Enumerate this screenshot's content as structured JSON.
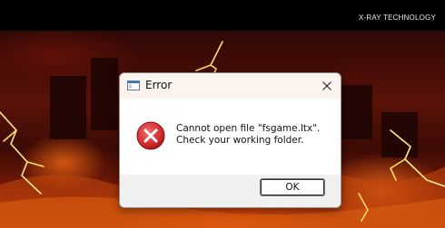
{
  "splash": {
    "brand": "X-RAY TECHNOLOGY"
  },
  "dialog": {
    "title": "Error",
    "message_line1": "Cannot open file \"fsgame.ltx\".",
    "message_line2": "Check your working folder.",
    "ok_label": "OK",
    "icon": "error-icon",
    "title_icon": "window-icon",
    "close_icon": "close-icon"
  },
  "colors": {
    "dialog_bg": "#fbf4ee",
    "error_red": "#d12b2b",
    "footer_bg": "#f0f0f0"
  }
}
